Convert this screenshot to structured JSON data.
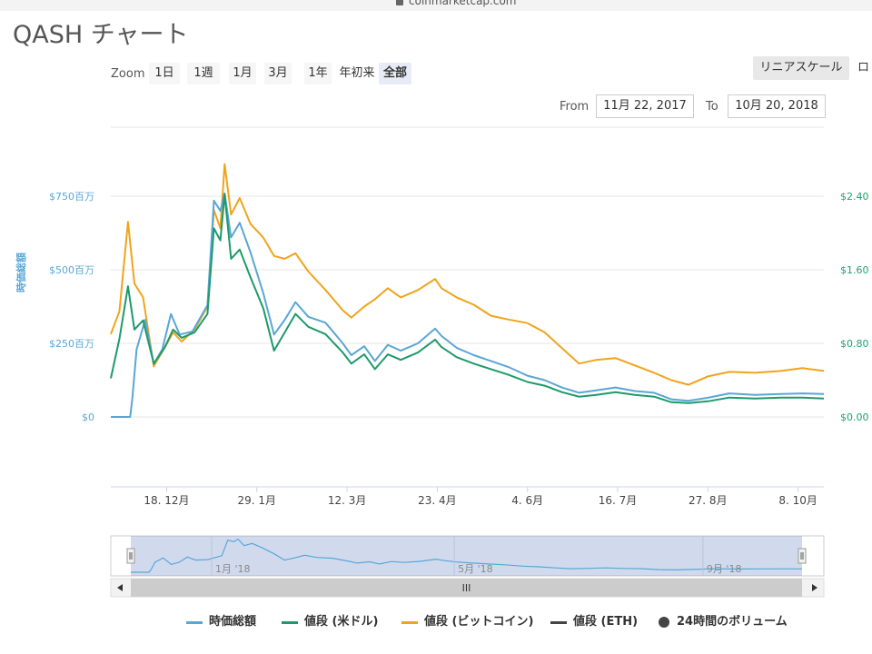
{
  "page": {
    "url": "coinmarketcap.com",
    "title": "QASH チャート"
  },
  "controls": {
    "zoom_label": "Zoom",
    "zoom_options": [
      "1日",
      "1週",
      "1月",
      "3月",
      "1年",
      "年初来",
      "全部"
    ],
    "zoom_active": "全部",
    "scale_label": "リニアスケール",
    "scale_label2": "ロ",
    "from_label": "From",
    "from_value": "11月 22, 2017",
    "to_label": "To",
    "to_value": "10月 20, 2018"
  },
  "chart_data": {
    "type": "line",
    "left_axis": {
      "label": "時価総額",
      "ticks": [
        "$0",
        "$250百万",
        "$500百万",
        "$750百万"
      ],
      "tick_values": [
        0,
        250,
        500,
        750
      ],
      "range": [
        0,
        800
      ],
      "color": "#5aa6d6"
    },
    "right_axis": {
      "ticks": [
        "$0.00",
        "$0.80",
        "$1.60",
        "$2.40"
      ],
      "tick_values": [
        0,
        0.8,
        1.6,
        2.4
      ],
      "range": [
        0,
        2.56
      ],
      "color": "#1ea16e"
    },
    "x_axis": {
      "range": [
        "2017-11-22",
        "2018-10-20"
      ],
      "ticks": [
        {
          "label": "18. 12月",
          "date": "2017-12-18"
        },
        {
          "label": "29. 1月",
          "date": "2018-01-29"
        },
        {
          "label": "12. 3月",
          "date": "2018-03-12"
        },
        {
          "label": "23. 4月",
          "date": "2018-04-23"
        },
        {
          "label": "4. 6月",
          "date": "2018-06-04"
        },
        {
          "label": "16. 7月",
          "date": "2018-07-16"
        },
        {
          "label": "27. 8月",
          "date": "2018-08-27"
        },
        {
          "label": "8. 10月",
          "date": "2018-10-08"
        }
      ]
    },
    "series": [
      {
        "name": "時価総額",
        "axis": "left",
        "color": "#5aa6d6",
        "points": [
          [
            "2017-11-22",
            0
          ],
          [
            "2017-12-01",
            0
          ],
          [
            "2017-12-02",
            60
          ],
          [
            "2017-12-04",
            230
          ],
          [
            "2017-12-08",
            330
          ],
          [
            "2017-12-12",
            180
          ],
          [
            "2017-12-16",
            230
          ],
          [
            "2017-12-20",
            350
          ],
          [
            "2017-12-24",
            280
          ],
          [
            "2017-12-30",
            290
          ],
          [
            "2018-01-06",
            380
          ],
          [
            "2018-01-09",
            735
          ],
          [
            "2018-01-12",
            700
          ],
          [
            "2018-01-14",
            760
          ],
          [
            "2018-01-17",
            610
          ],
          [
            "2018-01-21",
            660
          ],
          [
            "2018-01-26",
            560
          ],
          [
            "2018-02-01",
            420
          ],
          [
            "2018-02-06",
            280
          ],
          [
            "2018-02-11",
            330
          ],
          [
            "2018-02-16",
            390
          ],
          [
            "2018-02-22",
            340
          ],
          [
            "2018-03-02",
            320
          ],
          [
            "2018-03-10",
            250
          ],
          [
            "2018-03-14",
            210
          ],
          [
            "2018-03-20",
            240
          ],
          [
            "2018-03-25",
            190
          ],
          [
            "2018-03-31",
            245
          ],
          [
            "2018-04-06",
            225
          ],
          [
            "2018-04-14",
            250
          ],
          [
            "2018-04-22",
            300
          ],
          [
            "2018-04-25",
            275
          ],
          [
            "2018-05-02",
            235
          ],
          [
            "2018-05-10",
            210
          ],
          [
            "2018-05-18",
            190
          ],
          [
            "2018-05-26",
            170
          ],
          [
            "2018-06-04",
            140
          ],
          [
            "2018-06-12",
            125
          ],
          [
            "2018-06-20",
            100
          ],
          [
            "2018-06-28",
            82
          ],
          [
            "2018-07-06",
            90
          ],
          [
            "2018-07-15",
            100
          ],
          [
            "2018-07-24",
            88
          ],
          [
            "2018-08-02",
            82
          ],
          [
            "2018-08-10",
            60
          ],
          [
            "2018-08-18",
            55
          ],
          [
            "2018-08-27",
            65
          ],
          [
            "2018-09-06",
            80
          ],
          [
            "2018-09-18",
            75
          ],
          [
            "2018-09-30",
            78
          ],
          [
            "2018-10-10",
            80
          ],
          [
            "2018-10-20",
            78
          ]
        ]
      },
      {
        "name": "値段 (米ドル)",
        "axis": "right",
        "color": "#1e9a6a",
        "points": [
          [
            "2017-11-22",
            0.42
          ],
          [
            "2017-11-26",
            0.85
          ],
          [
            "2017-11-30",
            1.42
          ],
          [
            "2017-12-03",
            0.95
          ],
          [
            "2017-12-07",
            1.05
          ],
          [
            "2017-12-12",
            0.58
          ],
          [
            "2017-12-17",
            0.75
          ],
          [
            "2017-12-21",
            0.95
          ],
          [
            "2017-12-25",
            0.86
          ],
          [
            "2017-12-31",
            0.92
          ],
          [
            "2018-01-06",
            1.12
          ],
          [
            "2018-01-09",
            2.05
          ],
          [
            "2018-01-12",
            1.92
          ],
          [
            "2018-01-14",
            2.42
          ],
          [
            "2018-01-17",
            1.72
          ],
          [
            "2018-01-21",
            1.82
          ],
          [
            "2018-01-26",
            1.52
          ],
          [
            "2018-02-01",
            1.18
          ],
          [
            "2018-02-06",
            0.72
          ],
          [
            "2018-02-11",
            0.92
          ],
          [
            "2018-02-16",
            1.12
          ],
          [
            "2018-02-22",
            0.98
          ],
          [
            "2018-03-02",
            0.9
          ],
          [
            "2018-03-10",
            0.7
          ],
          [
            "2018-03-14",
            0.58
          ],
          [
            "2018-03-20",
            0.68
          ],
          [
            "2018-03-25",
            0.52
          ],
          [
            "2018-03-31",
            0.68
          ],
          [
            "2018-04-06",
            0.62
          ],
          [
            "2018-04-14",
            0.7
          ],
          [
            "2018-04-22",
            0.84
          ],
          [
            "2018-04-25",
            0.76
          ],
          [
            "2018-05-02",
            0.65
          ],
          [
            "2018-05-10",
            0.58
          ],
          [
            "2018-05-18",
            0.52
          ],
          [
            "2018-05-26",
            0.46
          ],
          [
            "2018-06-04",
            0.38
          ],
          [
            "2018-06-12",
            0.34
          ],
          [
            "2018-06-20",
            0.27
          ],
          [
            "2018-06-28",
            0.22
          ],
          [
            "2018-07-06",
            0.24
          ],
          [
            "2018-07-15",
            0.27
          ],
          [
            "2018-07-24",
            0.24
          ],
          [
            "2018-08-02",
            0.22
          ],
          [
            "2018-08-10",
            0.16
          ],
          [
            "2018-08-18",
            0.15
          ],
          [
            "2018-08-27",
            0.17
          ],
          [
            "2018-09-06",
            0.21
          ],
          [
            "2018-09-18",
            0.2
          ],
          [
            "2018-09-30",
            0.21
          ],
          [
            "2018-10-10",
            0.21
          ],
          [
            "2018-10-20",
            0.2
          ]
        ]
      },
      {
        "name": "値段 (ビットコイン)",
        "axis": "right",
        "color": "#f0a41c",
        "points": [
          [
            "2017-11-22",
            0.9
          ],
          [
            "2017-11-26",
            1.15
          ],
          [
            "2017-11-30",
            2.12
          ],
          [
            "2017-12-03",
            1.45
          ],
          [
            "2017-12-07",
            1.3
          ],
          [
            "2017-12-12",
            0.55
          ],
          [
            "2017-12-17",
            0.75
          ],
          [
            "2017-12-21",
            0.92
          ],
          [
            "2017-12-25",
            0.82
          ],
          [
            "2017-12-31",
            0.95
          ],
          [
            "2018-01-06",
            1.2
          ],
          [
            "2018-01-09",
            2.25
          ],
          [
            "2018-01-12",
            2.05
          ],
          [
            "2018-01-14",
            2.75
          ],
          [
            "2018-01-17",
            2.2
          ],
          [
            "2018-01-21",
            2.38
          ],
          [
            "2018-01-26",
            2.1
          ],
          [
            "2018-02-01",
            1.95
          ],
          [
            "2018-02-06",
            1.75
          ],
          [
            "2018-02-11",
            1.72
          ],
          [
            "2018-02-16",
            1.78
          ],
          [
            "2018-02-22",
            1.58
          ],
          [
            "2018-03-02",
            1.38
          ],
          [
            "2018-03-10",
            1.16
          ],
          [
            "2018-03-14",
            1.08
          ],
          [
            "2018-03-20",
            1.2
          ],
          [
            "2018-03-25",
            1.28
          ],
          [
            "2018-03-31",
            1.4
          ],
          [
            "2018-04-06",
            1.3
          ],
          [
            "2018-04-14",
            1.38
          ],
          [
            "2018-04-22",
            1.5
          ],
          [
            "2018-04-25",
            1.4
          ],
          [
            "2018-05-02",
            1.3
          ],
          [
            "2018-05-10",
            1.22
          ],
          [
            "2018-05-18",
            1.1
          ],
          [
            "2018-05-26",
            1.06
          ],
          [
            "2018-06-04",
            1.02
          ],
          [
            "2018-06-12",
            0.92
          ],
          [
            "2018-06-20",
            0.75
          ],
          [
            "2018-06-28",
            0.58
          ],
          [
            "2018-07-06",
            0.62
          ],
          [
            "2018-07-15",
            0.64
          ],
          [
            "2018-07-24",
            0.56
          ],
          [
            "2018-08-02",
            0.48
          ],
          [
            "2018-08-10",
            0.4
          ],
          [
            "2018-08-18",
            0.35
          ],
          [
            "2018-08-27",
            0.44
          ],
          [
            "2018-09-06",
            0.49
          ],
          [
            "2018-09-18",
            0.48
          ],
          [
            "2018-09-30",
            0.5
          ],
          [
            "2018-10-10",
            0.53
          ],
          [
            "2018-10-20",
            0.5
          ]
        ]
      }
    ],
    "navigator": {
      "labels": [
        {
          "label": "1月 '18",
          "date": "2018-01-01"
        },
        {
          "label": "5月 '18",
          "date": "2018-05-01"
        },
        {
          "label": "9月 '18",
          "date": "2018-09-01"
        }
      ],
      "scroll_thumb": "III"
    },
    "legend": [
      {
        "name": "時価総額",
        "color": "#5aa6d6",
        "marker": "line"
      },
      {
        "name": "値段 (米ドル)",
        "color": "#1e9a6a",
        "marker": "line"
      },
      {
        "name": "値段 (ビットコイン)",
        "color": "#f0a41c",
        "marker": "line"
      },
      {
        "name": "値段 (ETH)",
        "color": "#444444",
        "marker": "line"
      },
      {
        "name": "24時間のボリューム",
        "color": "#444444",
        "marker": "dot"
      }
    ]
  }
}
